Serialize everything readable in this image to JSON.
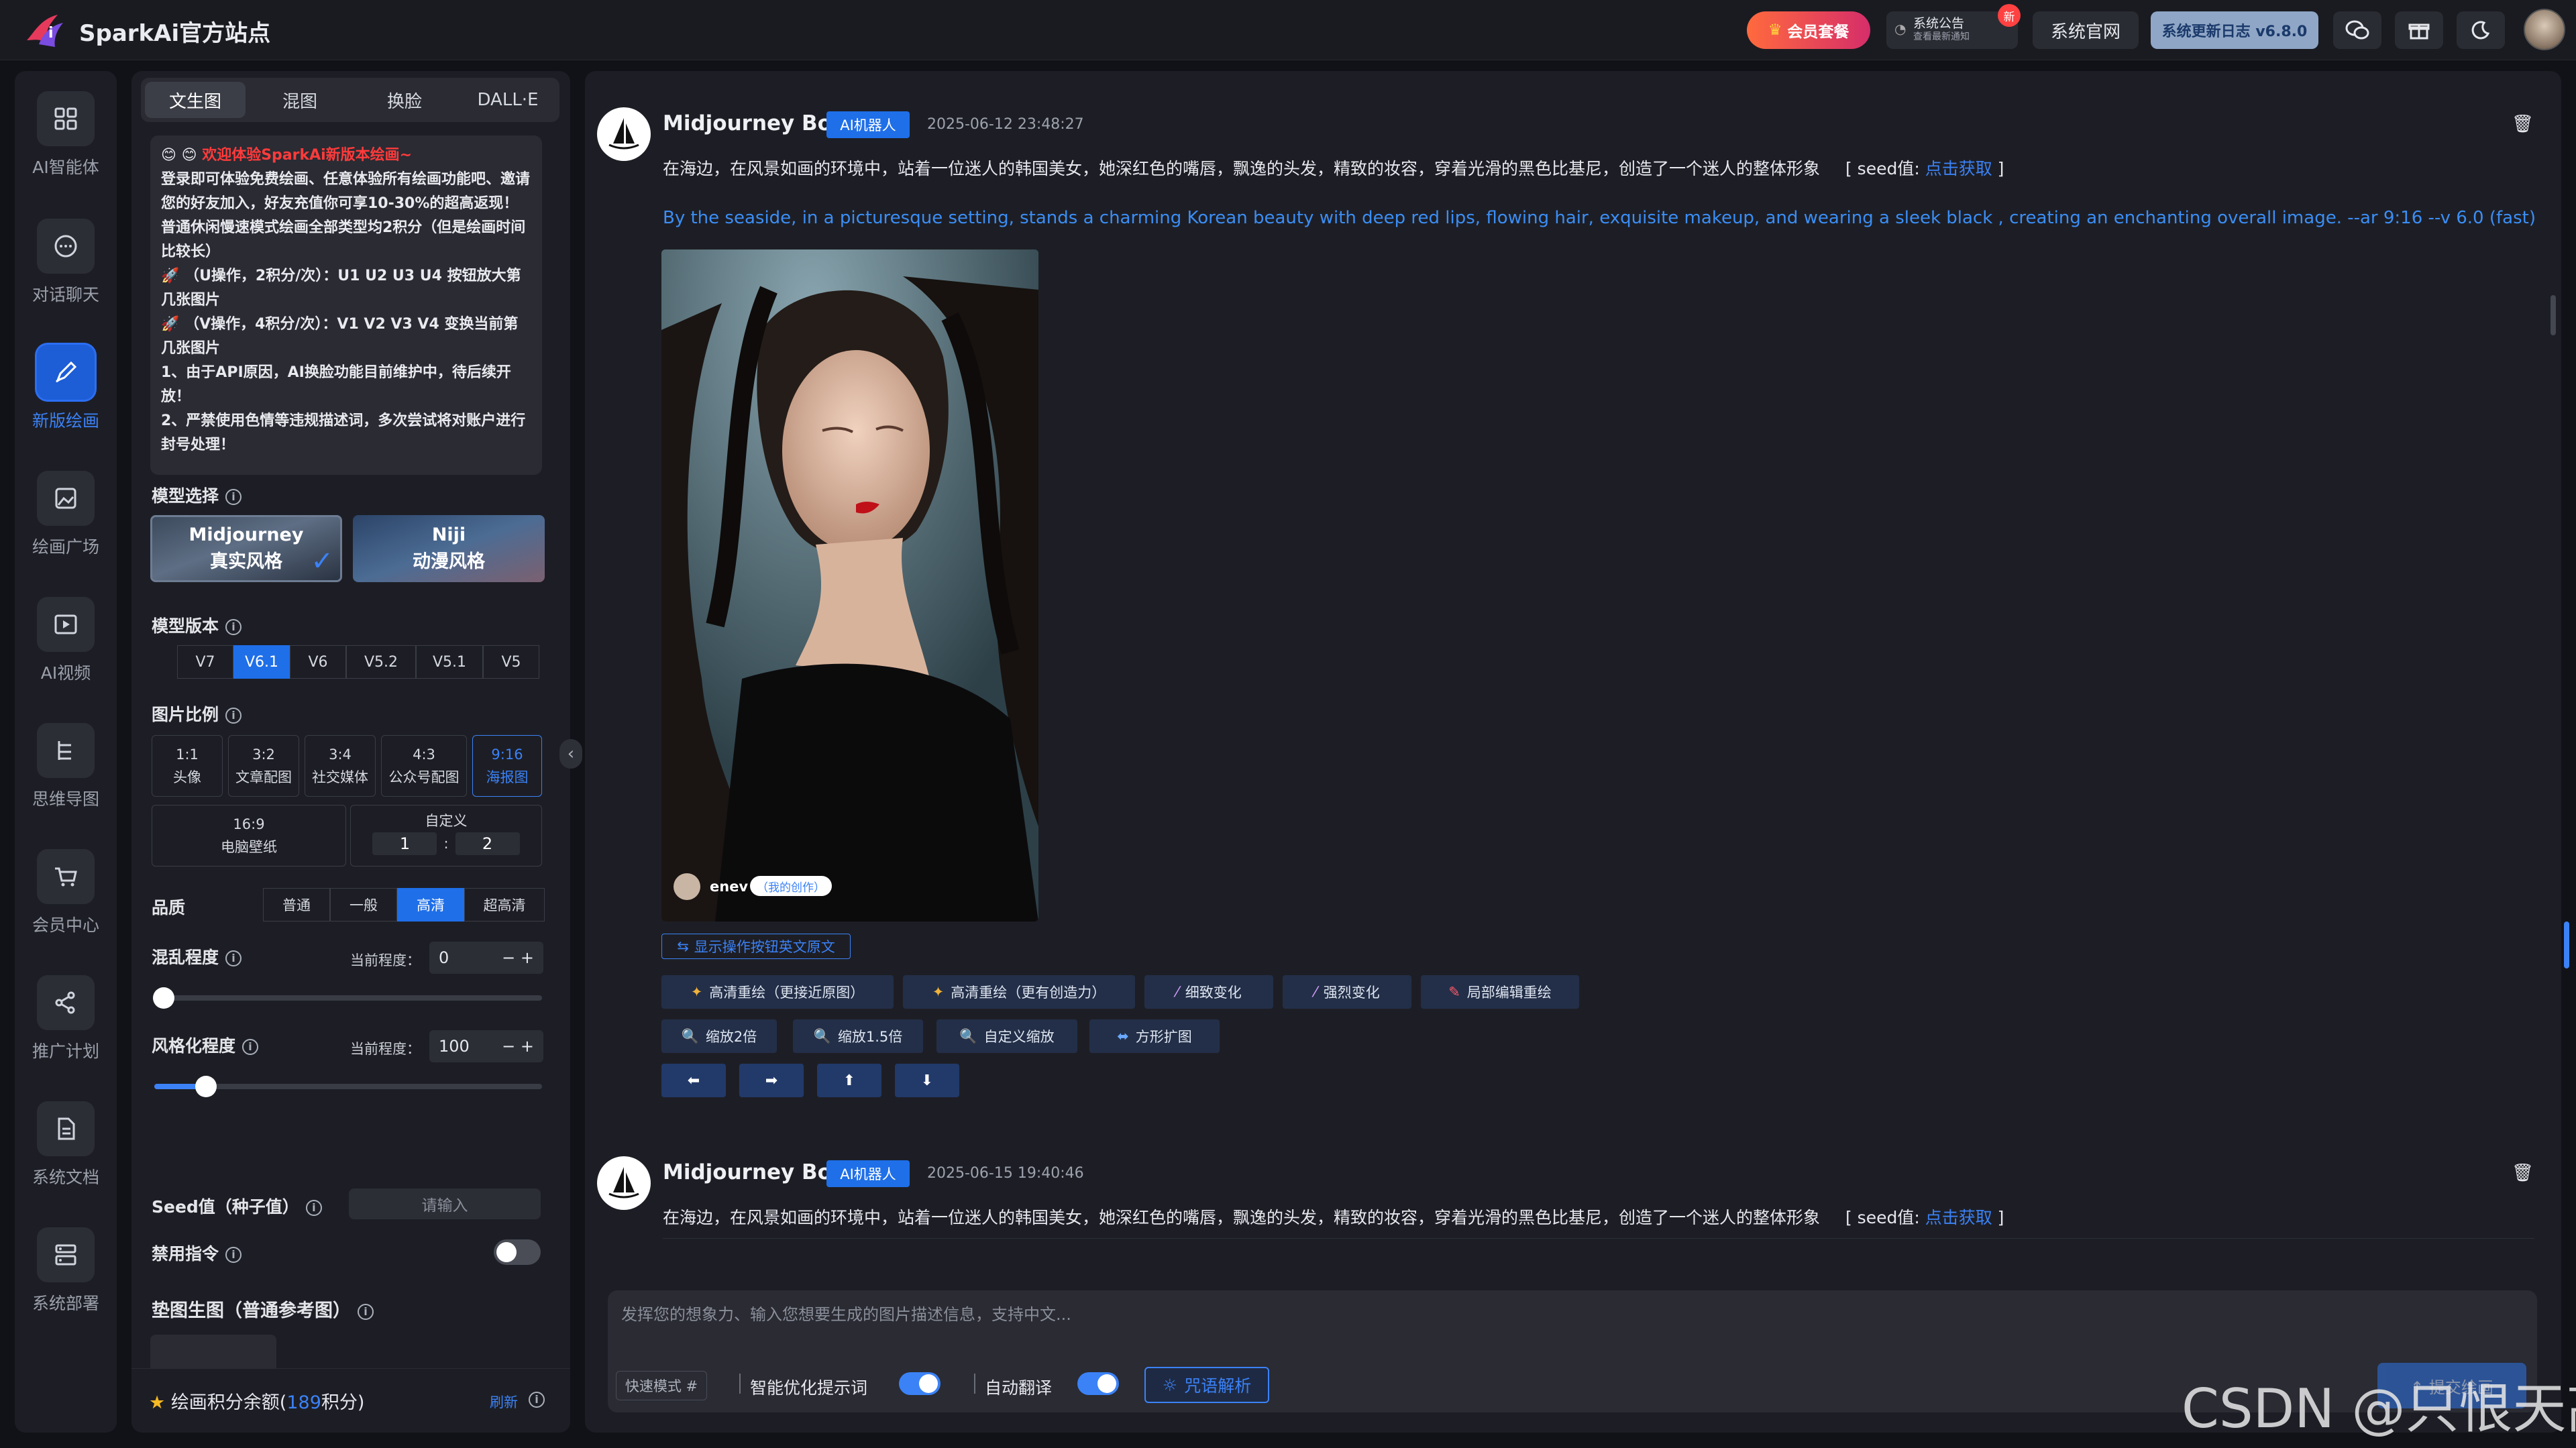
{
  "header": {
    "brand": "SparkAi官方站点",
    "vip_label": "会员套餐",
    "notice_title": "系统公告",
    "notice_sub": "查看最新通知",
    "notice_badge": "新",
    "official_label": "系统官网",
    "changelog_label": "系统更新日志 v6.8.0",
    "icons": [
      "wechat-icon",
      "gift-icon",
      "moon-icon"
    ]
  },
  "nav": {
    "items": [
      {
        "label": "AI智能体",
        "icon": "grid-icon"
      },
      {
        "label": "对话聊天",
        "icon": "chat-icon"
      },
      {
        "label": "新版绘画",
        "icon": "brush-icon",
        "active": true
      },
      {
        "label": "绘画广场",
        "icon": "gallery-icon"
      },
      {
        "label": "AI视频",
        "icon": "video-icon"
      },
      {
        "label": "思维导图",
        "icon": "mindmap-icon"
      },
      {
        "label": "会员中心",
        "icon": "cart-icon"
      },
      {
        "label": "推广计划",
        "icon": "share-icon"
      },
      {
        "label": "系统文档",
        "icon": "doc-icon"
      },
      {
        "label": "系统部署",
        "icon": "server-icon"
      }
    ]
  },
  "panel": {
    "tabs": [
      "文生图",
      "混图",
      "换脸",
      "DALL·E"
    ],
    "active_tab": 0,
    "info": {
      "line1": "欢迎体验SparkAi新版本绘画~",
      "line2": "登录即可体验免费绘画、任意体验所有绘画功能吧、邀请您的好友加入，好友充值你可享10-30%的超高返现！普通休闲慢速模式绘画全部类型均2积分（但是绘画时间比较长）",
      "line3": "（U操作，2积分/次）：U1 U2 U3 U4 按钮放大第几张图片",
      "line4": "（V操作，4积分/次）：V1 V2 V3 V4 变换当前第几张图片",
      "line5": "1、由于API原因，AI换脸功能目前维护中，待后续开放！",
      "line6": "2、严禁使用色情等违规描述词，多次尝试将对账户进行封号处理！"
    },
    "model_select_label": "模型选择",
    "models": [
      {
        "name": "Midjourney",
        "style": "真实风格",
        "selected": true
      },
      {
        "name": "Niji",
        "style": "动漫风格",
        "selected": false
      }
    ],
    "version_label": "模型版本",
    "versions": [
      "V7",
      "V6.1",
      "V6",
      "V5.2",
      "V5.1",
      "V5"
    ],
    "active_version": 1,
    "ratio_label": "图片比例",
    "ratios": [
      {
        "r": "1:1",
        "t": "头像"
      },
      {
        "r": "3:2",
        "t": "文章配图"
      },
      {
        "r": "3:4",
        "t": "社交媒体"
      },
      {
        "r": "4:3",
        "t": "公众号配图"
      },
      {
        "r": "9:16",
        "t": "海报图"
      }
    ],
    "active_ratio": 4,
    "ratio_wide": {
      "r": "16:9",
      "t": "电脑壁纸"
    },
    "ratio_custom": {
      "label": "自定义",
      "w": "1",
      "sep": ":",
      "h": "2"
    },
    "quality_label": "品质",
    "qualities": [
      "普通",
      "一般",
      "高清",
      "超高清"
    ],
    "active_quality": 2,
    "chaos_label": "混乱程度",
    "chaos_current_label": "当前程度：",
    "chaos_value": "0",
    "chaos_level": 0.0,
    "stylize_label": "风格化程度",
    "stylize_current_label": "当前程度：",
    "stylize_value": "100",
    "stylize_level": 0.12,
    "stepper_minus": "−",
    "stepper_plus": "+",
    "seed_label": "Seed值（种子值）",
    "seed_placeholder": "请输入",
    "no_label": "禁用指令",
    "no_enabled": false,
    "ref_label": "垫图生图（普通参考图）",
    "points_label": "绘画积分余额(",
    "points_value": "189",
    "points_unit": "积分)",
    "refresh_label": "刷新"
  },
  "chat": {
    "messages": [
      {
        "sender": "Midjourney Bot",
        "badge": "AI机器人",
        "time": "2025-06-12 23:48:27",
        "prompt": "在海边，在风景如画的环境中，站着一位迷人的韩国美女，她深红色的嘴唇，飘逸的头发，精致的妆容，穿着光滑的黑色比基尼，创造了一个迷人的整体形象",
        "seed_prefix": "[ seed值: ",
        "seed_link": "点击获取",
        "seed_suffix": " ]",
        "english": "By the seaside, in a picturesque setting, stands a charming Korean beauty with deep red lips, flowing hair, exquisite makeup, and wearing a sleek black , creating an enchanting overall image. --ar 9:16 --v 6.0  (fast)",
        "image_user": "enev",
        "image_tag": "（我的创作）",
        "show_original": "显示操作按钮英文原文",
        "actions_row1": [
          "高清重绘（更接近原图）",
          "高清重绘（更有创造力）",
          "细致变化",
          "强烈变化",
          "局部编辑重绘"
        ],
        "actions_row2": [
          "缩放2倍",
          "缩放1.5倍",
          "自定义缩放",
          "方形扩图"
        ],
        "arrows": [
          "⬅",
          "➡",
          "⬆",
          "⬇"
        ]
      },
      {
        "sender": "Midjourney Bot",
        "badge": "AI机器人",
        "time": "2025-06-15 19:40:46",
        "prompt": "在海边，在风景如画的环境中，站着一位迷人的韩国美女，她深红色的嘴唇，飘逸的头发，精致的妆容，穿着光滑的黑色比基尼，创造了一个迷人的整体形象",
        "seed_prefix": "[ seed值: ",
        "seed_link": "点击获取",
        "seed_suffix": " ]"
      }
    ],
    "composer": {
      "placeholder": "发挥您的想象力、输入您想要生成的图片描述信息，支持中文...",
      "mode_label": "快速模式 #",
      "smart_label": "智能优化提示词",
      "smart_on": true,
      "translate_label": "自动翻译",
      "translate_on": true,
      "spell_label": "咒语解析",
      "send_label": "↑ 提交绘画"
    }
  },
  "watermark": "CSDN @只恨天高",
  "colors": {
    "accent": "#1f6fe8",
    "bg": "#111218",
    "panel": "#1d1e25",
    "danger": "#ff3b3b"
  }
}
